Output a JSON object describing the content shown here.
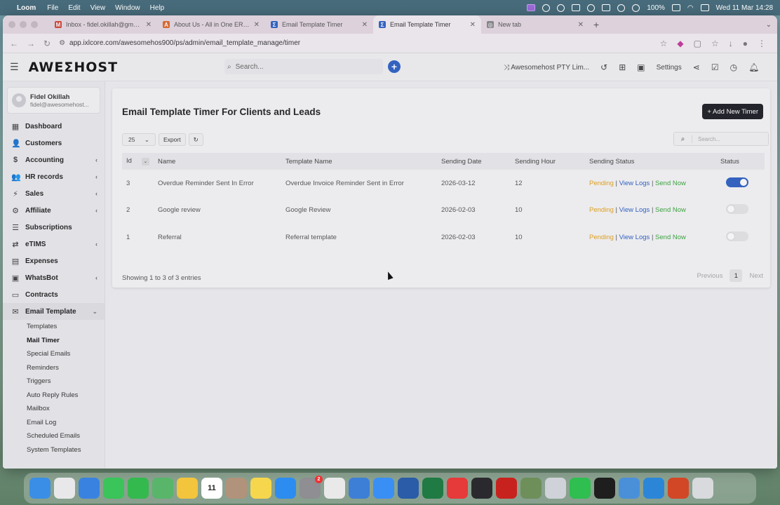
{
  "menubar": {
    "app": "Loom",
    "items": [
      "File",
      "Edit",
      "View",
      "Window",
      "Help"
    ],
    "battery": "100%",
    "datetime": "Wed 11 Mar 14:28"
  },
  "browser": {
    "tabs": [
      {
        "title": "Inbox - fidel.okillah@gmail.com",
        "color": "#d44638",
        "glyph": "M"
      },
      {
        "title": "About Us - All in One ERP| Cl...",
        "color": "#e06a2c",
        "glyph": "A"
      },
      {
        "title": "Email Template Timer",
        "color": "#2f62c4",
        "glyph": "Σ"
      },
      {
        "title": "Email Template Timer",
        "color": "#2f62c4",
        "glyph": "Σ",
        "active": true
      },
      {
        "title": "New tab",
        "color": "#888",
        "glyph": "◎"
      }
    ],
    "url": "app.ixlcore.com/awesomehos900/ps/admin/email_template_manage/timer"
  },
  "header": {
    "logo": "AWEΣHOST",
    "search_placeholder": "Search...",
    "company": "Awesomehost PTY Lim...",
    "settings": "Settings"
  },
  "sidebar": {
    "user": {
      "name": "Fidel Okillah",
      "email": "fidel@awesomehost..."
    },
    "items": [
      {
        "label": "Dashboard",
        "icon": "▦"
      },
      {
        "label": "Customers",
        "icon": "👤"
      },
      {
        "label": "Accounting",
        "icon": "$",
        "chev": "‹"
      },
      {
        "label": "HR records",
        "icon": "👥",
        "chev": "‹"
      },
      {
        "label": "Sales",
        "icon": "⚡",
        "chev": "‹"
      },
      {
        "label": "Affiliate",
        "icon": "⚙",
        "chev": "‹"
      },
      {
        "label": "Subscriptions",
        "icon": "☰"
      },
      {
        "label": "eTIMS",
        "icon": "⇄",
        "chev": "‹"
      },
      {
        "label": "Expenses",
        "icon": "▤"
      },
      {
        "label": "WhatsBot",
        "icon": "▣",
        "chev": "‹"
      },
      {
        "label": "Contracts",
        "icon": "▭"
      },
      {
        "label": "Email Template",
        "icon": "✉",
        "chev": "⌄",
        "open": true
      }
    ],
    "subitems": [
      "Templates",
      "Mail Timer",
      "Special Emails",
      "Reminders",
      "Triggers",
      "Auto Reply Rules",
      "Mailbox",
      "Email Log",
      "Scheduled Emails",
      "System Templates"
    ],
    "active_subitem": "Mail Timer"
  },
  "main": {
    "title": "Email Template Timer For Clients and Leads",
    "add_button": "+ Add New Timer",
    "page_size": "25",
    "export": "Export",
    "search_placeholder": "Search...",
    "columns": [
      "Id",
      "Name",
      "Template Name",
      "Sending Date",
      "Sending Hour",
      "Sending Status",
      "Status"
    ],
    "rows": [
      {
        "id": "3",
        "name": "Overdue Reminder Sent In Error",
        "template": "Overdue Invoice Reminder Sent in Error",
        "date": "2026-03-12",
        "hour": "12",
        "status_on": true
      },
      {
        "id": "2",
        "name": "Google review",
        "template": "Google Review",
        "date": "2026-02-03",
        "hour": "10",
        "status_on": false
      },
      {
        "id": "1",
        "name": "Referral",
        "template": "Referral template",
        "date": "2026-02-03",
        "hour": "10",
        "status_on": false
      }
    ],
    "sending_status": {
      "pending": "Pending",
      "view_logs": "View Logs",
      "send_now": "Send Now",
      "separator": "|"
    },
    "showing": "Showing 1 to 3 of 3 entries",
    "pager": {
      "previous": "Previous",
      "page": "1",
      "next": "Next"
    }
  },
  "dock": {
    "apps": [
      {
        "name": "finder",
        "color": "#3b8ee6"
      },
      {
        "name": "launchpad",
        "color": "#e8e8ea"
      },
      {
        "name": "mail",
        "color": "#3a82e0"
      },
      {
        "name": "messages",
        "color": "#3ac45a"
      },
      {
        "name": "facetime",
        "color": "#33b94d"
      },
      {
        "name": "maps",
        "color": "#58b56a"
      },
      {
        "name": "photos",
        "color": "#f2c53d"
      },
      {
        "name": "calendar",
        "color": "#ffffff",
        "glyph": "11"
      },
      {
        "name": "contacts",
        "color": "#b0937a"
      },
      {
        "name": "notes",
        "color": "#f6d64c"
      },
      {
        "name": "appstore",
        "color": "#2d8cf0"
      },
      {
        "name": "settings",
        "color": "#8e8e93",
        "badge": "2"
      },
      {
        "name": "chrome",
        "color": "#e9e9e9"
      },
      {
        "name": "xcode",
        "color": "#3d7fd6"
      },
      {
        "name": "safari",
        "color": "#3a8ff5"
      },
      {
        "name": "word",
        "color": "#2b5ca8"
      },
      {
        "name": "excel",
        "color": "#1f7a43"
      },
      {
        "name": "anydesk",
        "color": "#e6393a"
      },
      {
        "name": "obs",
        "color": "#2a2a2e"
      },
      {
        "name": "acrobat",
        "color": "#c8221e"
      },
      {
        "name": "stack",
        "color": "#6e8f5a"
      },
      {
        "name": "disk",
        "color": "#cfd2d8"
      },
      {
        "name": "whatsapp",
        "color": "#2fbe50"
      },
      {
        "name": "terminal",
        "color": "#1e1e1e"
      },
      {
        "name": "gear",
        "color": "#4a90d9"
      },
      {
        "name": "quick",
        "color": "#2b86d8"
      },
      {
        "name": "powerpoint",
        "color": "#d24726"
      },
      {
        "name": "trash",
        "color": "#d8dadd"
      }
    ]
  }
}
